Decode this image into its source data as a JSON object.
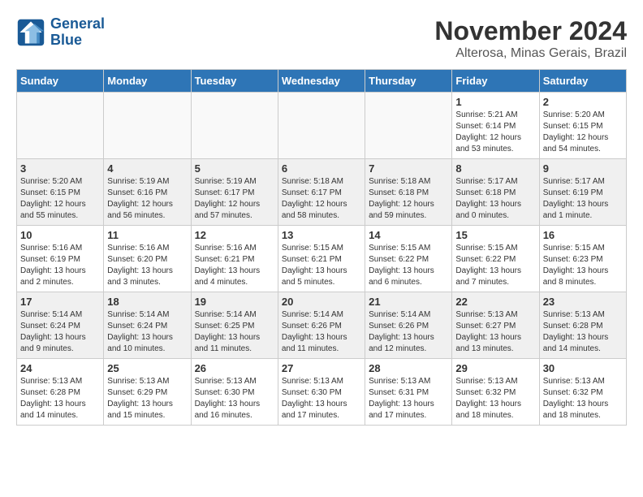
{
  "header": {
    "logo_line1": "General",
    "logo_line2": "Blue",
    "month": "November 2024",
    "location": "Alterosa, Minas Gerais, Brazil"
  },
  "days_of_week": [
    "Sunday",
    "Monday",
    "Tuesday",
    "Wednesday",
    "Thursday",
    "Friday",
    "Saturday"
  ],
  "weeks": [
    [
      {
        "day": "",
        "info": ""
      },
      {
        "day": "",
        "info": ""
      },
      {
        "day": "",
        "info": ""
      },
      {
        "day": "",
        "info": ""
      },
      {
        "day": "",
        "info": ""
      },
      {
        "day": "1",
        "info": "Sunrise: 5:21 AM\nSunset: 6:14 PM\nDaylight: 12 hours and 53 minutes."
      },
      {
        "day": "2",
        "info": "Sunrise: 5:20 AM\nSunset: 6:15 PM\nDaylight: 12 hours and 54 minutes."
      }
    ],
    [
      {
        "day": "3",
        "info": "Sunrise: 5:20 AM\nSunset: 6:15 PM\nDaylight: 12 hours and 55 minutes."
      },
      {
        "day": "4",
        "info": "Sunrise: 5:19 AM\nSunset: 6:16 PM\nDaylight: 12 hours and 56 minutes."
      },
      {
        "day": "5",
        "info": "Sunrise: 5:19 AM\nSunset: 6:17 PM\nDaylight: 12 hours and 57 minutes."
      },
      {
        "day": "6",
        "info": "Sunrise: 5:18 AM\nSunset: 6:17 PM\nDaylight: 12 hours and 58 minutes."
      },
      {
        "day": "7",
        "info": "Sunrise: 5:18 AM\nSunset: 6:18 PM\nDaylight: 12 hours and 59 minutes."
      },
      {
        "day": "8",
        "info": "Sunrise: 5:17 AM\nSunset: 6:18 PM\nDaylight: 13 hours and 0 minutes."
      },
      {
        "day": "9",
        "info": "Sunrise: 5:17 AM\nSunset: 6:19 PM\nDaylight: 13 hours and 1 minute."
      }
    ],
    [
      {
        "day": "10",
        "info": "Sunrise: 5:16 AM\nSunset: 6:19 PM\nDaylight: 13 hours and 2 minutes."
      },
      {
        "day": "11",
        "info": "Sunrise: 5:16 AM\nSunset: 6:20 PM\nDaylight: 13 hours and 3 minutes."
      },
      {
        "day": "12",
        "info": "Sunrise: 5:16 AM\nSunset: 6:21 PM\nDaylight: 13 hours and 4 minutes."
      },
      {
        "day": "13",
        "info": "Sunrise: 5:15 AM\nSunset: 6:21 PM\nDaylight: 13 hours and 5 minutes."
      },
      {
        "day": "14",
        "info": "Sunrise: 5:15 AM\nSunset: 6:22 PM\nDaylight: 13 hours and 6 minutes."
      },
      {
        "day": "15",
        "info": "Sunrise: 5:15 AM\nSunset: 6:22 PM\nDaylight: 13 hours and 7 minutes."
      },
      {
        "day": "16",
        "info": "Sunrise: 5:15 AM\nSunset: 6:23 PM\nDaylight: 13 hours and 8 minutes."
      }
    ],
    [
      {
        "day": "17",
        "info": "Sunrise: 5:14 AM\nSunset: 6:24 PM\nDaylight: 13 hours and 9 minutes."
      },
      {
        "day": "18",
        "info": "Sunrise: 5:14 AM\nSunset: 6:24 PM\nDaylight: 13 hours and 10 minutes."
      },
      {
        "day": "19",
        "info": "Sunrise: 5:14 AM\nSunset: 6:25 PM\nDaylight: 13 hours and 11 minutes."
      },
      {
        "day": "20",
        "info": "Sunrise: 5:14 AM\nSunset: 6:26 PM\nDaylight: 13 hours and 11 minutes."
      },
      {
        "day": "21",
        "info": "Sunrise: 5:14 AM\nSunset: 6:26 PM\nDaylight: 13 hours and 12 minutes."
      },
      {
        "day": "22",
        "info": "Sunrise: 5:13 AM\nSunset: 6:27 PM\nDaylight: 13 hours and 13 minutes."
      },
      {
        "day": "23",
        "info": "Sunrise: 5:13 AM\nSunset: 6:28 PM\nDaylight: 13 hours and 14 minutes."
      }
    ],
    [
      {
        "day": "24",
        "info": "Sunrise: 5:13 AM\nSunset: 6:28 PM\nDaylight: 13 hours and 14 minutes."
      },
      {
        "day": "25",
        "info": "Sunrise: 5:13 AM\nSunset: 6:29 PM\nDaylight: 13 hours and 15 minutes."
      },
      {
        "day": "26",
        "info": "Sunrise: 5:13 AM\nSunset: 6:30 PM\nDaylight: 13 hours and 16 minutes."
      },
      {
        "day": "27",
        "info": "Sunrise: 5:13 AM\nSunset: 6:30 PM\nDaylight: 13 hours and 17 minutes."
      },
      {
        "day": "28",
        "info": "Sunrise: 5:13 AM\nSunset: 6:31 PM\nDaylight: 13 hours and 17 minutes."
      },
      {
        "day": "29",
        "info": "Sunrise: 5:13 AM\nSunset: 6:32 PM\nDaylight: 13 hours and 18 minutes."
      },
      {
        "day": "30",
        "info": "Sunrise: 5:13 AM\nSunset: 6:32 PM\nDaylight: 13 hours and 18 minutes."
      }
    ]
  ]
}
